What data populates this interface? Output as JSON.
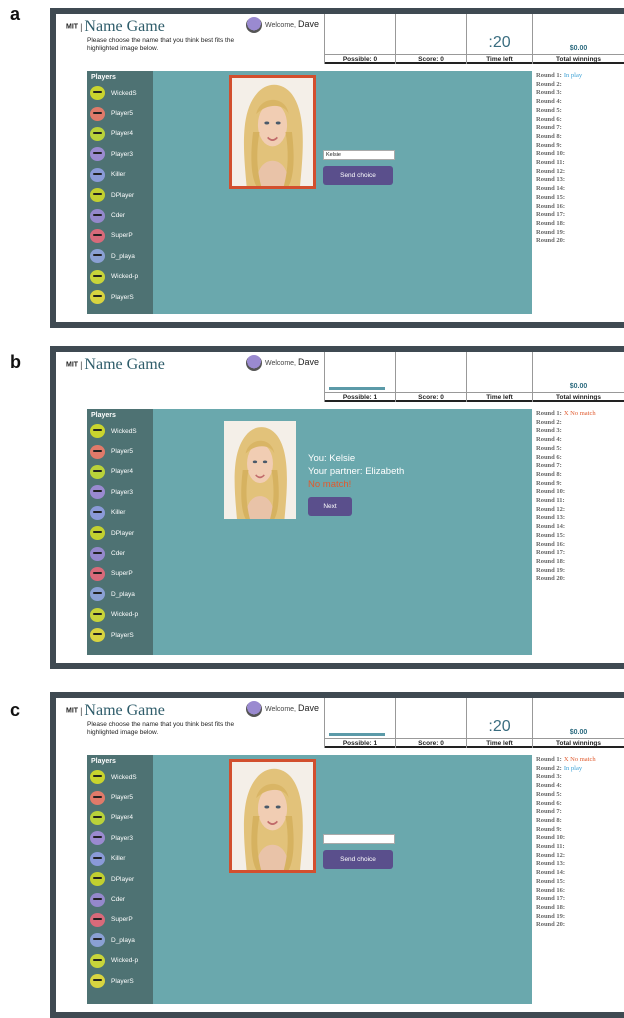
{
  "panels": [
    {
      "letter": "a",
      "header": {
        "mit": "MIT",
        "sep": "|",
        "name": "Name Game",
        "instruction": "Please choose the name that you think best fits the highlighted image below.",
        "welcome": "Welcome,",
        "user": "Dave"
      },
      "stats": {
        "possible": "Possible: 0",
        "score": "Score: 0",
        "time_label": "Time left",
        "time_value": ":20",
        "money": "$0.00",
        "winnings_label": "Total winnings"
      },
      "input_value": "Kelsie",
      "send_label": "Send choice",
      "round_status": [
        [
          "Round 1:",
          "In play",
          "play"
        ]
      ]
    },
    {
      "letter": "b",
      "header": {
        "mit": "MIT",
        "sep": "|",
        "name": "Name Game",
        "welcome": "Welcome,",
        "user": "Dave"
      },
      "stats": {
        "possible": "Possible: 1",
        "score": "Score: 0",
        "time_label": "Time left",
        "money": "$0.00",
        "winnings_label": "Total winnings"
      },
      "result": {
        "you": "You: Kelsie",
        "partner": "Your partner: Elizabeth",
        "verdict": "No match!"
      },
      "next_label": "Next",
      "round_status": [
        [
          "Round 1:",
          "X No match",
          "nomatch"
        ]
      ]
    },
    {
      "letter": "c",
      "header": {
        "mit": "MIT",
        "sep": "|",
        "name": "Name Game",
        "instruction": "Please choose the name that you think best fits the highlighted image below.",
        "welcome": "Welcome,",
        "user": "Dave"
      },
      "stats": {
        "possible": "Possible: 1",
        "score": "Score: 0",
        "time_label": "Time left",
        "time_value": ":20",
        "money": "$0.00",
        "winnings_label": "Total winnings"
      },
      "input_value": "",
      "send_label": "Send choice",
      "round_status": [
        [
          "Round 1:",
          "X No match",
          "nomatch"
        ],
        [
          "Round 2:",
          "In play",
          "play"
        ]
      ]
    }
  ],
  "sidebar": {
    "title": "Players",
    "players": [
      {
        "name": "WickedS",
        "color": "#c9d42e"
      },
      {
        "name": "Player5",
        "color": "#e07a6a"
      },
      {
        "name": "Player4",
        "color": "#b9d23a"
      },
      {
        "name": "Player3",
        "color": "#9a8ad0"
      },
      {
        "name": "Killer",
        "color": "#8a9ad8"
      },
      {
        "name": "DPlayer",
        "color": "#c2d030"
      },
      {
        "name": "Cder",
        "color": "#9488cc"
      },
      {
        "name": "SuperP",
        "color": "#d86a7a"
      },
      {
        "name": "D_playa",
        "color": "#8aa0d4"
      },
      {
        "name": "Wicked-p",
        "color": "#c8d43a"
      },
      {
        "name": "PlayerS",
        "color": "#d8d440"
      }
    ]
  },
  "rounds": [
    "Round 1:",
    "Round 2:",
    "Round 3:",
    "Round 4:",
    "Round 5:",
    "Round 6:",
    "Round 7:",
    "Round 8:",
    "Round 9:",
    "Round 10:",
    "Round 11:",
    "Round 12:",
    "Round 13:",
    "Round 14:",
    "Round 15:",
    "Round 16:",
    "Round 17:",
    "Round 18:",
    "Round 19:",
    "Round 20:"
  ],
  "colors": {
    "frame": "#3f4a52",
    "sidebar": "#4e7273",
    "play_area": "#6aa8ad",
    "highlight_border": "#d24f2e",
    "button": "#5a4f8c",
    "in_play": "#3aa0d5",
    "no_match": "#e05a2e"
  },
  "icons": {
    "welcome_avatar": "avatar-icon",
    "player_avatar": "player-avatar-icon",
    "photo": "woman-portrait-image"
  }
}
